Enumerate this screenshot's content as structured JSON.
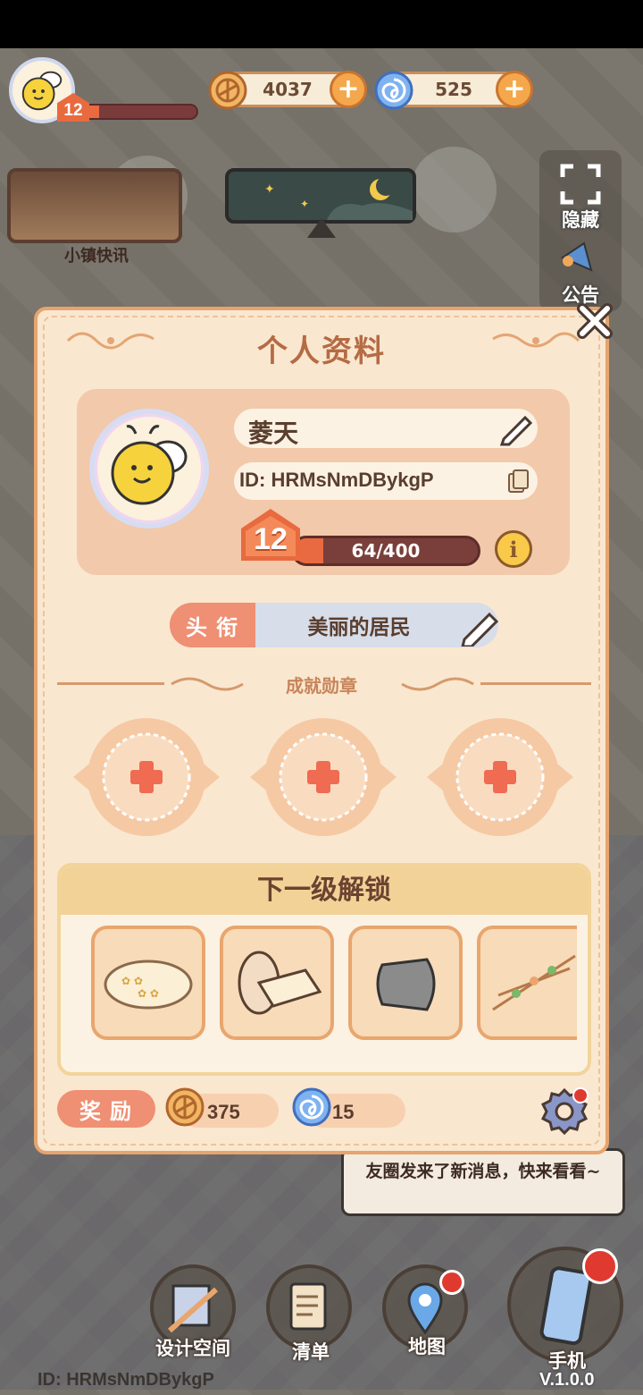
{
  "hud": {
    "level": "12",
    "xp_fraction": 0.16,
    "coins": "4037",
    "gems": "525",
    "coin_plus": "+",
    "gem_plus": "+"
  },
  "left_menu": {
    "news_label": "小镇快讯"
  },
  "right_menu": {
    "hide_label": "隐藏",
    "notice_label": "公告"
  },
  "profile_modal": {
    "title": "个人资料",
    "name": "菱天",
    "id": "ID: HRMsNmDBykgP",
    "level": "12",
    "xp_text": "64/400",
    "xp_fraction": 0.16,
    "info_icon": "i",
    "title_tag": "头衔",
    "title_value": "美丽的居民",
    "achievements_label": "成就勋章",
    "unlock_header": "下一级解锁",
    "unlock_items": [
      "flower-rug-icon",
      "pillow-icon",
      "cushion-icon",
      "string-lights-icon"
    ],
    "reward_tag": "奖励",
    "reward_coins": "375",
    "reward_gems": "15"
  },
  "toast": {
    "message": "友圈发来了新消息，快来看看~"
  },
  "dock": {
    "design_label": "设计空间",
    "list_label": "清单",
    "map_label": "地图",
    "phone_label": "手机"
  },
  "footer": {
    "id": "ID:  HRMsNmDBykgP",
    "version": "V.1.0.0"
  },
  "colors": {
    "modal_bg": "#fae7cf",
    "modal_border": "#e6a46e",
    "accent_orange": "#e86a3e",
    "tag_coral": "#ef8f73",
    "title_blue": "#d7dde9"
  }
}
